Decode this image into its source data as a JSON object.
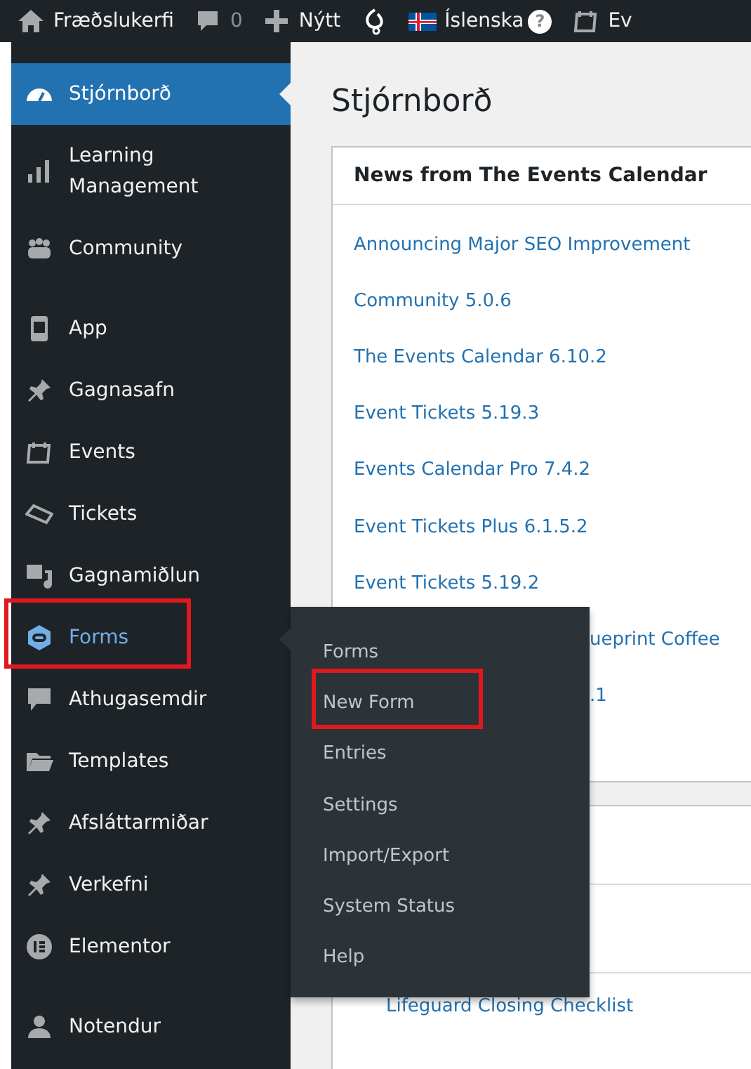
{
  "top_bar": {
    "items": [
      {
        "kind": "site",
        "label": "Fræðslukerfi"
      },
      {
        "kind": "comments",
        "label": "0",
        "dim": true
      },
      {
        "kind": "new",
        "label": "Nýtt"
      },
      {
        "kind": "logo"
      },
      {
        "kind": "language",
        "label": "Íslenska",
        "badge": "?"
      },
      {
        "kind": "events",
        "label": "Ev"
      }
    ]
  },
  "sidebar": {
    "groups": [
      {
        "items": [
          {
            "label": "Stjórnborð",
            "selected": true,
            "highlighted": false
          },
          {
            "label": "Learning Management",
            "selected": false,
            "highlighted": false
          },
          {
            "label": "Community",
            "selected": false,
            "highlighted": false
          }
        ]
      },
      {
        "items": [
          {
            "label": "App",
            "selected": false,
            "highlighted": false
          },
          {
            "label": "Gagnasafn",
            "selected": false,
            "highlighted": false
          },
          {
            "label": "Events",
            "selected": false,
            "highlighted": false
          },
          {
            "label": "Tickets",
            "selected": false,
            "highlighted": false
          },
          {
            "label": "Gagnamiðlun",
            "selected": false,
            "highlighted": false
          },
          {
            "label": "Forms",
            "selected": false,
            "highlighted": true,
            "flyout": [
              {
                "label": "Forms",
                "highlighted": false
              },
              {
                "label": "New Form",
                "highlighted": true
              },
              {
                "label": "Entries",
                "highlighted": false
              },
              {
                "label": "Settings",
                "highlighted": false
              },
              {
                "label": "Import/Export",
                "highlighted": false
              },
              {
                "label": "System Status",
                "highlighted": false
              },
              {
                "label": "Help",
                "highlighted": false
              }
            ]
          },
          {
            "label": "Athugasemdir",
            "selected": false,
            "highlighted": false
          },
          {
            "label": "Templates",
            "selected": false,
            "highlighted": false
          },
          {
            "label": "Afsláttarmiðar",
            "selected": false,
            "highlighted": false
          },
          {
            "label": "Verkefni",
            "selected": false,
            "highlighted": false
          },
          {
            "label": "Elementor",
            "selected": false,
            "highlighted": false
          }
        ]
      },
      {
        "items": [
          {
            "label": "Notendur",
            "selected": false,
            "highlighted": false
          }
        ]
      }
    ]
  },
  "page_title": "Stjórnborð",
  "news_widget": {
    "title": "News from The Events Calendar",
    "links": [
      {
        "text": "Announcing Major SEO Improvement",
        "kind": "full"
      },
      {
        "text": "Community 5.0.6",
        "kind": "full"
      },
      {
        "text": "The Events Calendar 6.10.2",
        "kind": "full"
      },
      {
        "text": "Event Tickets 5.19.3",
        "kind": "full"
      },
      {
        "text": "Events Calendar Pro 7.4.2",
        "kind": "full"
      },
      {
        "text": "Event Tickets Plus 6.1.5.2",
        "kind": "full"
      },
      {
        "text": "Event Tickets 5.19.2",
        "kind": "full"
      },
      {
        "text": "ueprint Coffee",
        "kind": "covered"
      },
      {
        "text": ".1",
        "kind": "covered"
      }
    ]
  },
  "second_widget": {
    "links": [
      {
        "text": "Lifeguard Closing Checklist"
      }
    ]
  }
}
